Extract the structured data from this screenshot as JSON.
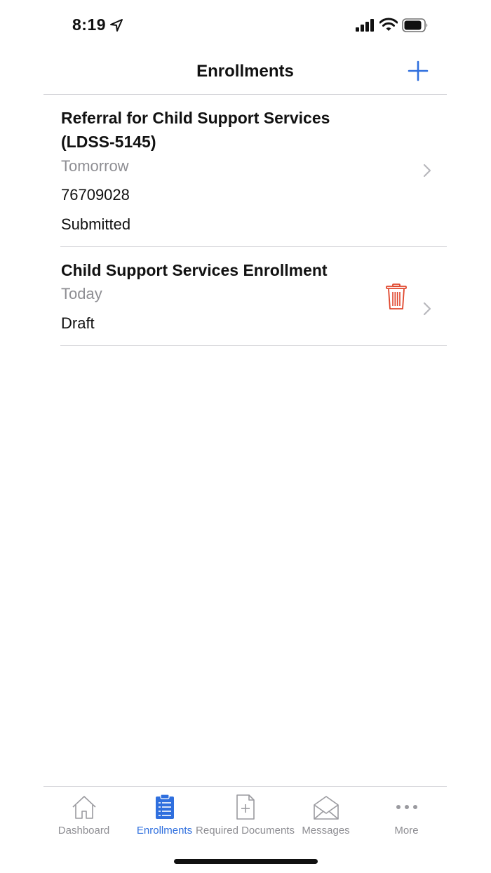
{
  "status_bar": {
    "time": "8:19"
  },
  "nav": {
    "title": "Enrollments"
  },
  "enrollments": [
    {
      "title": "Referral for Child Support Services (LDSS-5145)",
      "date": "Tomorrow",
      "number": "76709028",
      "status": "Submitted"
    },
    {
      "title": "Child Support Services Enrollment",
      "date": "Today",
      "status": "Draft"
    }
  ],
  "tabs": [
    {
      "label": "Dashboard",
      "icon": "home-icon"
    },
    {
      "label": "Enrollments",
      "icon": "clipboard-icon"
    },
    {
      "label": "Required Documents",
      "icon": "document-add-icon"
    },
    {
      "label": "Messages",
      "icon": "envelope-icon"
    },
    {
      "label": "More",
      "icon": "more-icon"
    }
  ],
  "colors": {
    "accent": "#2f6fde",
    "delete": "#e0452b",
    "secondary_text": "#8e8e93"
  }
}
